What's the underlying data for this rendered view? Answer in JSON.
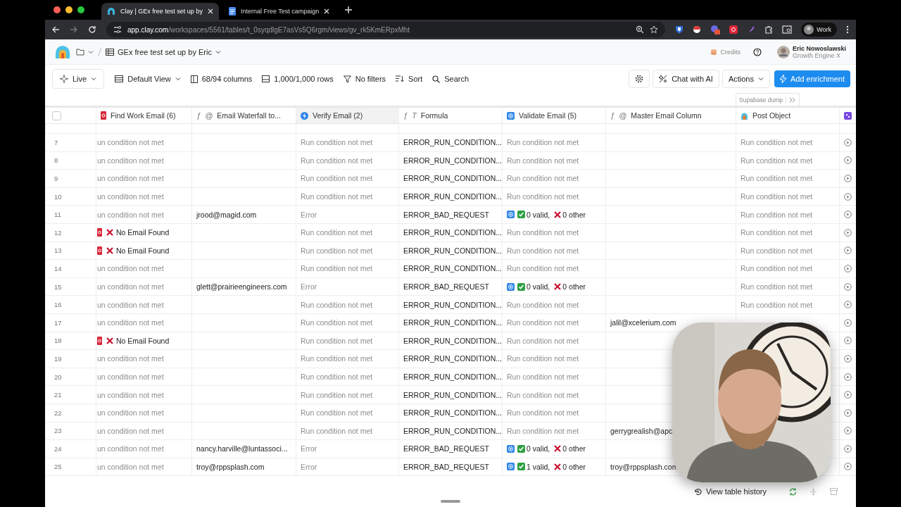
{
  "browser": {
    "tabs": [
      {
        "title": "Clay | GEx free test set up by",
        "selected": true
      },
      {
        "title": "Internal Free Test campaign",
        "selected": false
      }
    ],
    "url_host": "app.clay.com",
    "url_path": "/workspaces/5561/tables/t_0syqdlgE7asVs5Q6rgm/views/gv_rk5KmERpxMht",
    "profile": "Work"
  },
  "app_bar": {
    "breadcrumb": "GEx free test set up by Eric",
    "credits": "Credits",
    "user_name": "Eric Nowoslawski",
    "user_org": "Growth Engine X"
  },
  "toolbar": {
    "left": [
      {
        "kind": "live",
        "label": "Live"
      },
      {
        "kind": "view",
        "label": "Default View"
      },
      {
        "kind": "columns",
        "label": "68/94 columns"
      },
      {
        "kind": "rows",
        "label": "1,000/1,000 rows"
      },
      {
        "kind": "filter",
        "label": "No filters"
      },
      {
        "kind": "sort",
        "label": "Sort"
      },
      {
        "kind": "search",
        "label": "Search"
      }
    ],
    "chat": "Chat with AI",
    "actions": "Actions",
    "add": "Add enrichment"
  },
  "group_tag": "Supabase dump",
  "table": {
    "select_all": {
      "checked": false
    },
    "columns": [
      {
        "label": "Find Work Email (6)",
        "icons": [
          {
            "kind": "red-logo"
          }
        ]
      },
      {
        "label": "Email Waterfall to...",
        "icons": [
          {
            "kind": "glyph",
            "char": "ƒ"
          },
          {
            "kind": "glyph",
            "char": "@"
          }
        ]
      },
      {
        "label": "Verify Email (2)",
        "icons": [
          {
            "kind": "bolt"
          }
        ]
      },
      {
        "label": "Formula",
        "icons": [
          {
            "kind": "glyph",
            "char": "ƒ"
          },
          {
            "kind": "glyph",
            "char": "T"
          }
        ]
      },
      {
        "label": "Validate Email (5)",
        "icons": [
          {
            "kind": "at-square"
          }
        ]
      },
      {
        "label": "Master Email Column",
        "icons": [
          {
            "kind": "glyph",
            "char": "ƒ"
          },
          {
            "kind": "glyph",
            "char": "@"
          }
        ]
      },
      {
        "label": "Post Object",
        "icons": [
          {
            "kind": "clay"
          }
        ]
      },
      {
        "icons": [
          {
            "kind": "purple-app"
          }
        ]
      }
    ],
    "rows": [
      {
        "num": "7",
        "find": {
          "kind": "text",
          "text": "un condition not met"
        },
        "verify": "Run condition not met",
        "formula": "ERROR_RUN_CONDITION...",
        "validate": {
          "kind": "text",
          "text": "Run condition not met"
        },
        "post": "Run condition not met"
      },
      {
        "num": "8",
        "find": {
          "kind": "text",
          "text": "un condition not met"
        },
        "verify": "Run condition not met",
        "formula": "ERROR_RUN_CONDITION...",
        "validate": {
          "kind": "text",
          "text": "Run condition not met"
        },
        "post": "Run condition not met"
      },
      {
        "num": "9",
        "find": {
          "kind": "text",
          "text": "un condition not met"
        },
        "verify": "Run condition not met",
        "formula": "ERROR_RUN_CONDITION...",
        "validate": {
          "kind": "text",
          "text": "Run condition not met"
        },
        "post": "Run condition not met"
      },
      {
        "num": "10",
        "find": {
          "kind": "text",
          "text": "un condition not met"
        },
        "verify": "Run condition not met",
        "formula": "ERROR_RUN_CONDITION...",
        "validate": {
          "kind": "text",
          "text": "Run condition not met"
        },
        "post": "Run condition not met"
      },
      {
        "num": "11",
        "find": {
          "kind": "text",
          "text": "un condition not met"
        },
        "waterfall": "jrood@magid.com",
        "verify": "Error",
        "formula": "ERROR_BAD_REQUEST",
        "validate": {
          "kind": "result",
          "valid": "0 valid,",
          "other": "0 other"
        },
        "post": "Run condition not met"
      },
      {
        "num": "12",
        "find": {
          "kind": "not_found",
          "text": "No Email Found"
        },
        "verify": "Run condition not met",
        "formula": "ERROR_RUN_CONDITION...",
        "validate": {
          "kind": "text",
          "text": "Run condition not met"
        },
        "post": "Run condition not met"
      },
      {
        "num": "13",
        "find": {
          "kind": "not_found",
          "text": "No Email Found"
        },
        "verify": "Run condition not met",
        "formula": "ERROR_RUN_CONDITION...",
        "validate": {
          "kind": "text",
          "text": "Run condition not met"
        },
        "post": "Run condition not met"
      },
      {
        "num": "14",
        "find": {
          "kind": "text",
          "text": "un condition not met"
        },
        "verify": "Run condition not met",
        "formula": "ERROR_RUN_CONDITION...",
        "validate": {
          "kind": "text",
          "text": "Run condition not met"
        },
        "post": "Run condition not met"
      },
      {
        "num": "15",
        "find": {
          "kind": "text",
          "text": "un condition not met"
        },
        "waterfall": "glett@prairieengineers.com",
        "verify": "Error",
        "formula": "ERROR_BAD_REQUEST",
        "validate": {
          "kind": "result",
          "valid": "0 valid,",
          "other": "0 other"
        },
        "post": "Run condition not met"
      },
      {
        "num": "16",
        "find": {
          "kind": "text",
          "text": "un condition not met"
        },
        "verify": "Run condition not met",
        "formula": "ERROR_RUN_CONDITION...",
        "validate": {
          "kind": "text",
          "text": "Run condition not met"
        },
        "post": "Run condition not met"
      },
      {
        "num": "17",
        "find": {
          "kind": "text",
          "text": "un condition not met"
        },
        "verify": "Run condition not met",
        "formula": "ERROR_RUN_CONDITION...",
        "validate": {
          "kind": "text",
          "text": "Run condition not met"
        },
        "master": "jalil@xcelerium.com"
      },
      {
        "num": "18",
        "find": {
          "kind": "not_found",
          "text": "No Email Found"
        },
        "verify": "Run condition not met",
        "formula": "ERROR_RUN_CONDITION...",
        "validate": {
          "kind": "text",
          "text": "Run condition not met"
        }
      },
      {
        "num": "19",
        "find": {
          "kind": "text",
          "text": "un condition not met"
        },
        "verify": "Run condition not met",
        "formula": "ERROR_RUN_CONDITION...",
        "validate": {
          "kind": "text",
          "text": "Run condition not met"
        }
      },
      {
        "num": "20",
        "find": {
          "kind": "text",
          "text": "un condition not met"
        },
        "verify": "Run condition not met",
        "formula": "ERROR_RUN_CONDITION...",
        "validate": {
          "kind": "text",
          "text": "Run condition not met"
        }
      },
      {
        "num": "21",
        "find": {
          "kind": "text",
          "text": "un condition not met"
        },
        "verify": "Run condition not met",
        "formula": "ERROR_RUN_CONDITION...",
        "validate": {
          "kind": "text",
          "text": "Run condition not met"
        }
      },
      {
        "num": "22",
        "find": {
          "kind": "text",
          "text": "un condition not met"
        },
        "verify": "Run condition not met",
        "formula": "ERROR_RUN_CONDITION...",
        "validate": {
          "kind": "text",
          "text": "Run condition not met"
        }
      },
      {
        "num": "23",
        "find": {
          "kind": "text",
          "text": "un condition not met"
        },
        "verify": "Run condition not met",
        "formula": "ERROR_RUN_CONDITION...",
        "validate": {
          "kind": "text",
          "text": "Run condition not met"
        },
        "master": "gerrygrealish@apc"
      },
      {
        "num": "24",
        "find": {
          "kind": "text",
          "text": "un condition not met"
        },
        "waterfall": "nancy.harville@luntassoci...",
        "verify": "Error",
        "formula": "ERROR_BAD_REQUEST",
        "validate": {
          "kind": "result",
          "valid": "0 valid,",
          "other": "0 other"
        }
      },
      {
        "num": "25",
        "find": {
          "kind": "text",
          "text": "un condition not met"
        },
        "waterfall": "troy@rppsplash.com",
        "verify": "Error",
        "formula": "ERROR_BAD_REQUEST",
        "validate": {
          "kind": "result",
          "valid": "1 valid,",
          "other": "0 other"
        },
        "master": "troy@rppsplash.com"
      }
    ]
  },
  "footer": {
    "history": "View table history"
  }
}
